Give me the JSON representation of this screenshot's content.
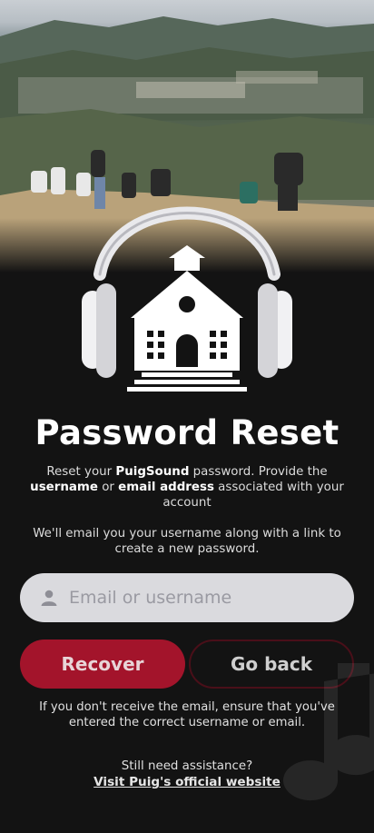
{
  "page": {
    "title": "Password Reset",
    "description": {
      "part1": "Reset your ",
      "brand": "PuigSound",
      "part2": " password. Provide the ",
      "username_word": "username",
      "part3": " or ",
      "email_word": "email address",
      "part4": " associated with your account"
    },
    "email_info": "We'll email you your username along with a link to create a new password."
  },
  "form": {
    "identifier_placeholder": "Email or username",
    "identifier_value": "",
    "recover_label": "Recover",
    "back_label": "Go back"
  },
  "footer": {
    "note": "If you don't receive the email, ensure that you've entered the correct username or email.",
    "assistance": "Still need assistance?",
    "link_label": "Visit Puig's official website"
  },
  "colors": {
    "background": "#131313",
    "accent": "#a3142b",
    "input_bg": "#dadade"
  },
  "icons": {
    "logo": "headphones-building-logo",
    "input": "user-icon"
  }
}
